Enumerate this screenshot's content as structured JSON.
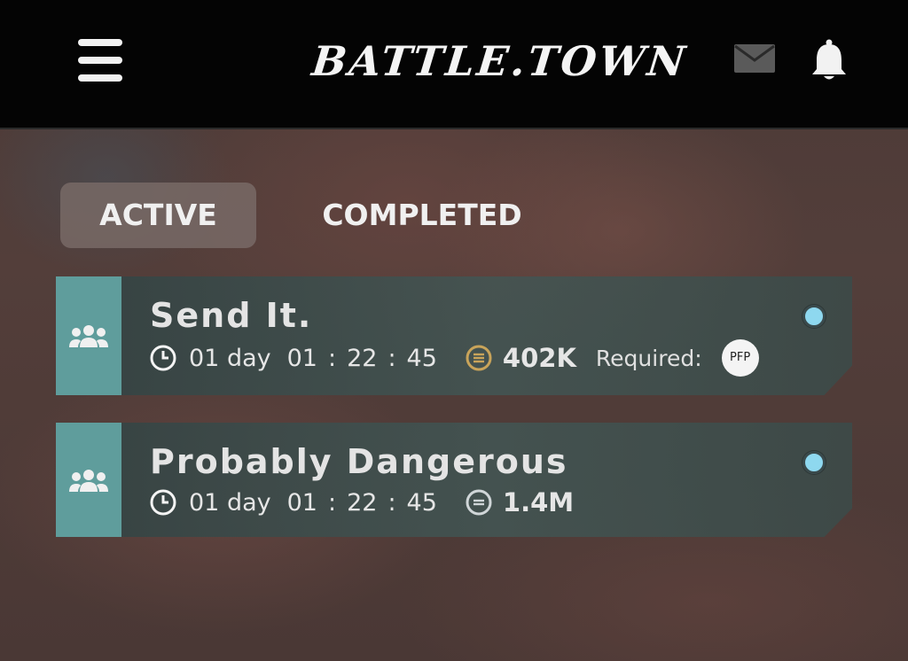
{
  "header": {
    "brand": "BATTLE.TOWN",
    "menu_icon": "hamburger-menu-icon",
    "mail_icon": "mail-icon",
    "notifications_icon": "bell-icon"
  },
  "tabs": [
    {
      "label": "ACTIVE",
      "selected": true
    },
    {
      "label": "COMPLETED",
      "selected": false
    }
  ],
  "battles": [
    {
      "title": "Send It.",
      "timer": {
        "days": "01 day",
        "hours": "01",
        "sep1": ":",
        "minutes": "22",
        "sep2": ":",
        "seconds": "45"
      },
      "reward": "402K",
      "required_label": "Required:",
      "required_badge": "PFP",
      "coin_color": "#c9a45a",
      "status": "active"
    },
    {
      "title": "Probably Dangerous",
      "timer": {
        "days": "01 day",
        "hours": "01",
        "sep1": ":",
        "minutes": "22",
        "sep2": ":",
        "seconds": "45"
      },
      "reward": "1.4M",
      "coin_color": "#d0d6d8",
      "status": "active"
    }
  ],
  "colors": {
    "header_bg": "#040404",
    "card_strip": "#5f9d9c",
    "status_dot": "#8ed8ef",
    "active_tab_bg": "#786a66"
  }
}
